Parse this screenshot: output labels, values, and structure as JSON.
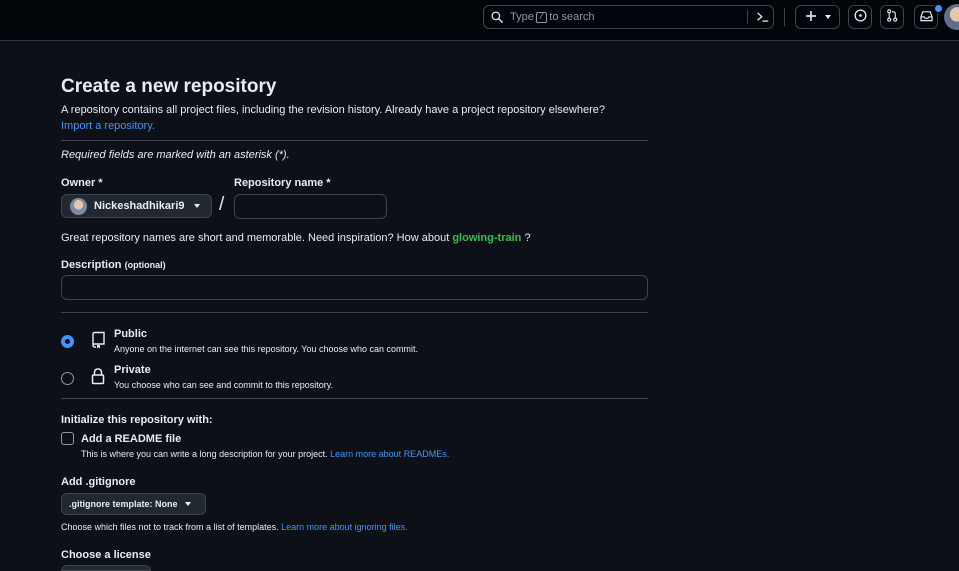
{
  "header": {
    "search": {
      "prefix": "Type",
      "key": "/",
      "suffix": "to search"
    },
    "icons": [
      "search-icon",
      "command-palette-icon",
      "plus-icon",
      "chevron-down-icon",
      "issues-icon",
      "pull-requests-icon",
      "inbox-icon"
    ]
  },
  "page": {
    "title": "Create a new repository",
    "intro": "A repository contains all project files, including the revision history. Already have a project repository elsewhere?",
    "import_link": "Import a repository.",
    "required_note": "Required fields are marked with an asterisk (*)."
  },
  "owner": {
    "label": "Owner *",
    "value": "Nickeshadhikari9"
  },
  "repo_name": {
    "label": "Repository name *",
    "value": "",
    "separator": "/"
  },
  "name_hint": {
    "text": "Great repository names are short and memorable. Need inspiration? How about",
    "suggestion": "glowing-train",
    "suffix": "?"
  },
  "description": {
    "label": "Description",
    "optional": "(optional)",
    "value": ""
  },
  "visibility": {
    "selected": "public",
    "public": {
      "title": "Public",
      "desc": "Anyone on the internet can see this repository. You choose who can commit."
    },
    "private": {
      "title": "Private",
      "desc": "You choose who can see and commit to this repository."
    }
  },
  "init": {
    "heading": "Initialize this repository with:",
    "readme_label": "Add a README file",
    "readme_checked": false,
    "readme_desc": "This is where you can write a long description for your project.",
    "readme_link": "Learn more about READMEs."
  },
  "gitignore": {
    "heading": "Add .gitignore",
    "button": ".gitignore template: None",
    "desc": "Choose which files not to track from a list of templates.",
    "link": "Learn more about ignoring files."
  },
  "license": {
    "heading": "Choose a license"
  },
  "colors": {
    "bg": "#0d1117",
    "link": "#4493f8",
    "suggestion": "#3fb950",
    "border": "#3d444d"
  }
}
